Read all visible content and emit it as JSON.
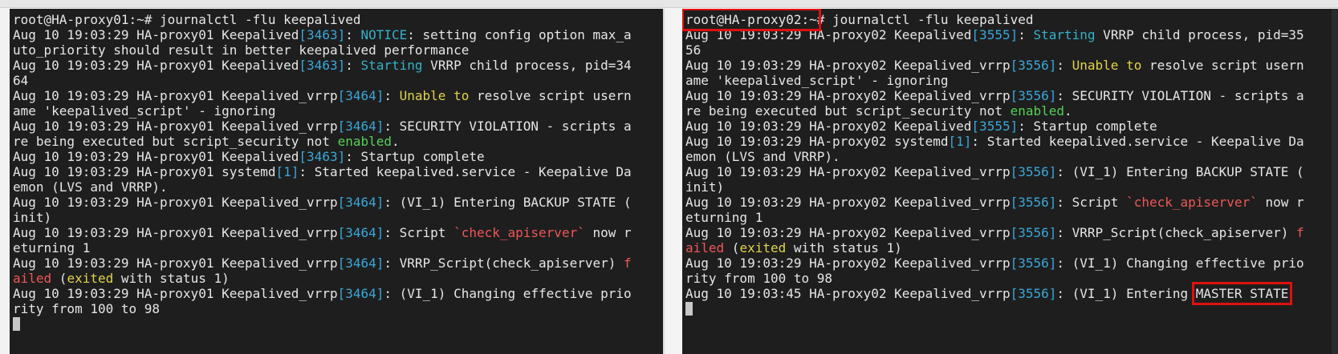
{
  "left_terminal": {
    "prompt": "root@HA-proxy01:~#",
    "command": " journalctl -flu keepalived",
    "log": [
      {
        "p": "Aug 10 19:03:29 HA-proxy01 Keepalived",
        "pid": "[3463]",
        "s": ": ",
        "notice": "NOTICE",
        "r": ": setting config option max_a"
      },
      {
        "t": "uto_priority should result in better keepalived performance"
      },
      {
        "p": "Aug 10 19:03:29 HA-proxy01 Keepalived",
        "pid": "[3463]",
        "s": ": ",
        "kw": "Starting",
        "r": " VRRP child process, pid=34"
      },
      {
        "t": "64"
      },
      {
        "p": "Aug 10 19:03:29 HA-proxy01 Keepalived_vrrp",
        "pid": "[3464]",
        "s": ": ",
        "kw": "Unable to",
        "r": " resolve script usern"
      },
      {
        "t": "ame 'keepalived_script' - ignoring"
      },
      {
        "p": "Aug 10 19:03:29 HA-proxy01 Keepalived_vrrp",
        "pid": "[3464]",
        "s": ": ",
        "r": "SECURITY VIOLATION - scripts a"
      },
      {
        "t1": "re being executed but script_security not ",
        "en": "enabled",
        "t2": "."
      },
      {
        "p": "Aug 10 19:03:29 HA-proxy01 Keepalived",
        "pid": "[3463]",
        "s": ": ",
        "r": "Startup complete"
      },
      {
        "p": "Aug 10 19:03:29 HA-proxy01 systemd",
        "pid": "[1]",
        "s": ": ",
        "r": "Started keepalived.service - Keepalive Da"
      },
      {
        "t": "emon (LVS and VRRP)."
      },
      {
        "p": "Aug 10 19:03:29 HA-proxy01 Keepalived_vrrp",
        "pid": "[3464]",
        "s": ": ",
        "r": "(VI_1) Entering BACKUP STATE ("
      },
      {
        "t": "init)"
      },
      {
        "p": "Aug 10 19:03:29 HA-proxy01 Keepalived_vrrp",
        "pid": "[3464]",
        "s": ": ",
        "r1": "Script ",
        "bt": "`check_apiserver`",
        "r2": " now r"
      },
      {
        "t": "eturning 1"
      },
      {
        "p": "Aug 10 19:03:29 HA-proxy01 Keepalived_vrrp",
        "pid": "[3464]",
        "s": ": ",
        "r1": "VRRP_Script(check_apiserver) ",
        "f": "f"
      },
      {
        "a": "ailed",
        "r1": " (",
        "ex": "exited",
        "r2": " with status 1)"
      },
      {
        "p": "Aug 10 19:03:29 HA-proxy01 Keepalived_vrrp",
        "pid": "[3464]",
        "s": ": ",
        "r": "(VI_1) Changing effective prio"
      },
      {
        "t": "rity from 100 to 98"
      }
    ]
  },
  "right_terminal": {
    "prompt": "root@HA-proxy02:~",
    "prompt_tail": "#",
    "command": " journalctl -flu keepalived",
    "log": [
      {
        "p": "Aug 10 19:03:29 HA-proxy02 Keepalived",
        "pid": "[3555]",
        "s": ": ",
        "kw": "Starting",
        "r": " VRRP child process, pid=35"
      },
      {
        "t": "56"
      },
      {
        "p": "Aug 10 19:03:29 HA-proxy02 Keepalived_vrrp",
        "pid": "[3556]",
        "s": ": ",
        "kw": "Unable to",
        "r": " resolve script usern"
      },
      {
        "t": "ame 'keepalived_script' - ignoring"
      },
      {
        "p": "Aug 10 19:03:29 HA-proxy02 Keepalived_vrrp",
        "pid": "[3556]",
        "s": ": ",
        "r": "SECURITY VIOLATION - scripts a"
      },
      {
        "t1": "re being executed but script_security not ",
        "en": "enabled",
        "t2": "."
      },
      {
        "p": "Aug 10 19:03:29 HA-proxy02 Keepalived",
        "pid": "[3555]",
        "s": ": ",
        "r": "Startup complete"
      },
      {
        "p": "Aug 10 19:03:29 HA-proxy02 systemd",
        "pid": "[1]",
        "s": ": ",
        "r": "Started keepalived.service - Keepalive Da"
      },
      {
        "t": "emon (LVS and VRRP)."
      },
      {
        "p": "Aug 10 19:03:29 HA-proxy02 Keepalived_vrrp",
        "pid": "[3556]",
        "s": ": ",
        "r": "(VI_1) Entering BACKUP STATE ("
      },
      {
        "t": "init)"
      },
      {
        "p": "Aug 10 19:03:29 HA-proxy02 Keepalived_vrrp",
        "pid": "[3556]",
        "s": ": ",
        "r1": "Script ",
        "bt": "`check_apiserver`",
        "r2": " now r"
      },
      {
        "t": "eturning 1"
      },
      {
        "p": "Aug 10 19:03:29 HA-proxy02 Keepalived_vrrp",
        "pid": "[3556]",
        "s": ": ",
        "r1": "VRRP_Script(check_apiserver) ",
        "f": "f"
      },
      {
        "a": "ailed",
        "r1": " (",
        "ex": "exited",
        "r2": " with status 1)"
      },
      {
        "p": "Aug 10 19:03:29 HA-proxy02 Keepalived_vrrp",
        "pid": "[3556]",
        "s": ": ",
        "r": "(VI_1) Changing effective prio"
      },
      {
        "t": "rity from 100 to 98"
      },
      {
        "p": "Aug 10 19:03:45 HA-proxy02 Keepalived_vrrp",
        "pid": "[3556]",
        "s": ": ",
        "r": "(VI_1) Entering ",
        "ms": "MASTER STATE"
      }
    ]
  },
  "colors": {
    "background": "#1e1e1e",
    "pid": "#3aa7d8",
    "keyword": "#35b0c8",
    "warning": "#e3d34b",
    "error": "#ef5757",
    "ok": "#55d055",
    "highlight_box": "#e01010"
  }
}
